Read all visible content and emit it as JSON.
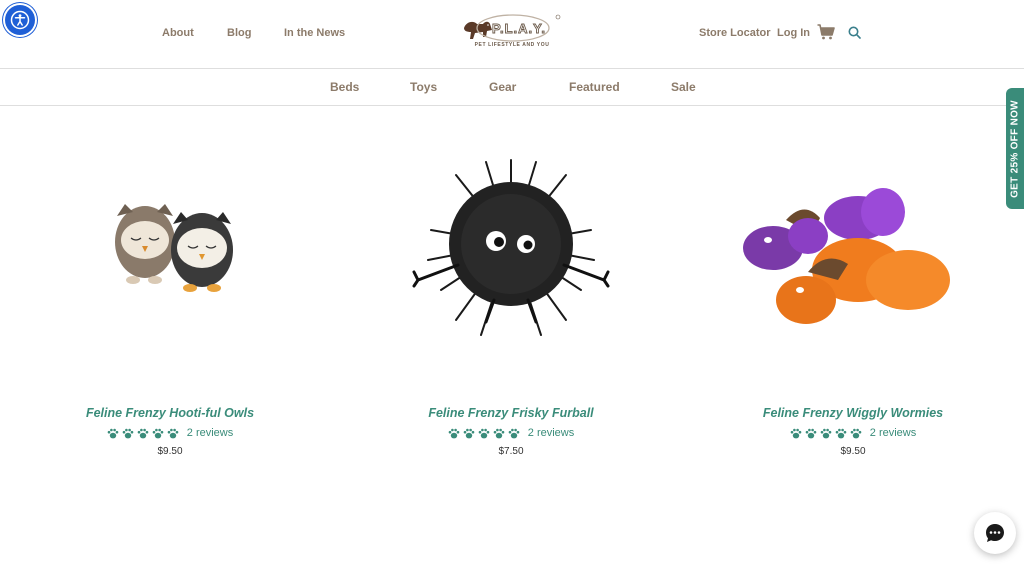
{
  "header": {
    "nav_left": [
      "About",
      "Blog",
      "In the News"
    ],
    "logo_name": "P.L.A.Y.",
    "logo_tagline": "PET LIFESTYLE AND YOU",
    "nav_right": [
      "Store Locator",
      "Log In"
    ]
  },
  "categories": [
    "Beds",
    "Toys",
    "Gear",
    "Featured",
    "Sale"
  ],
  "promo": {
    "label": "GET 25% OFF NOW"
  },
  "products": [
    {
      "title": "Feline Frenzy Hooti-ful Owls",
      "rating": 5,
      "reviews": "2 reviews",
      "price": "$9.50"
    },
    {
      "title": "Feline Frenzy Frisky Furball",
      "rating": 5,
      "reviews": "2 reviews",
      "price": "$7.50"
    },
    {
      "title": "Feline Frenzy Wiggly Wormies",
      "rating": 5,
      "reviews": "2 reviews",
      "price": "$9.50"
    }
  ],
  "colors": {
    "accent": "#3a8c7a",
    "nav_text": "#8c7b6a",
    "accessibility": "#1f5fd6"
  },
  "icons": [
    "accessibility-icon",
    "cart-icon",
    "search-icon",
    "paw-icon",
    "chat-icon"
  ]
}
